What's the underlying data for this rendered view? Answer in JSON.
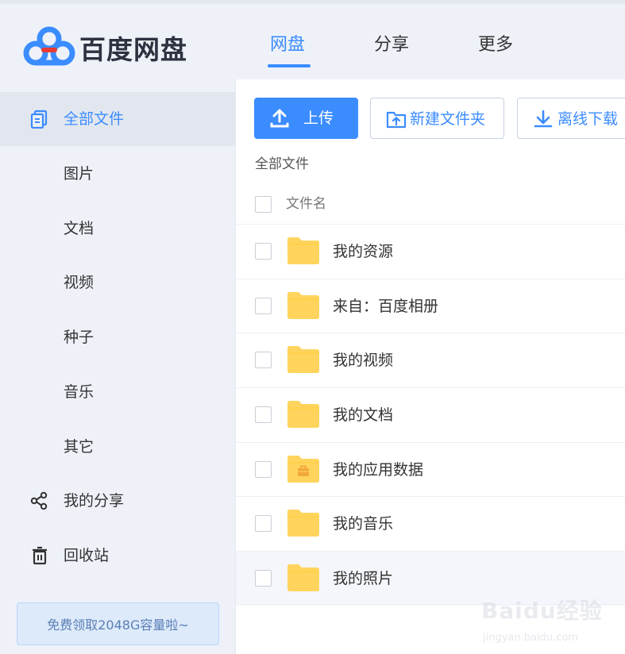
{
  "app": {
    "logo_text": "百度网盘"
  },
  "nav": {
    "tabs": [
      {
        "label": "网盘",
        "active": true
      },
      {
        "label": "分享",
        "active": false
      },
      {
        "label": "更多",
        "active": false
      }
    ]
  },
  "sidebar": {
    "items": [
      {
        "label": "全部文件",
        "icon": "files-icon",
        "active": true
      },
      {
        "label": "图片",
        "icon": null,
        "active": false
      },
      {
        "label": "文档",
        "icon": null,
        "active": false
      },
      {
        "label": "视频",
        "icon": null,
        "active": false
      },
      {
        "label": "种子",
        "icon": null,
        "active": false
      },
      {
        "label": "音乐",
        "icon": null,
        "active": false
      },
      {
        "label": "其它",
        "icon": null,
        "active": false
      },
      {
        "label": "我的分享",
        "icon": "share-icon",
        "active": false
      },
      {
        "label": "回收站",
        "icon": "trash-icon",
        "active": false
      }
    ],
    "promo": "免费领取2048G容量啦~"
  },
  "toolbar": {
    "upload_label": "上传",
    "new_folder_label": "新建文件夹",
    "offline_download_label": "离线下载"
  },
  "breadcrumb": "全部文件",
  "file_list": {
    "column_name": "文件名",
    "files": [
      {
        "name": "我的资源",
        "icon": "folder-icon"
      },
      {
        "name": "来自：百度相册",
        "icon": "folder-icon"
      },
      {
        "name": "我的视频",
        "icon": "folder-icon"
      },
      {
        "name": "我的文档",
        "icon": "folder-icon"
      },
      {
        "name": "我的应用数据",
        "icon": "app-folder-icon"
      },
      {
        "name": "我的音乐",
        "icon": "folder-icon"
      },
      {
        "name": "我的照片",
        "icon": "folder-icon"
      }
    ]
  },
  "watermark": {
    "text": "Baidu经验",
    "url": "jingyan.baidu.com"
  },
  "colors": {
    "accent": "#3b8cff",
    "folder": "#ffd45c",
    "background": "#eef2f8"
  }
}
